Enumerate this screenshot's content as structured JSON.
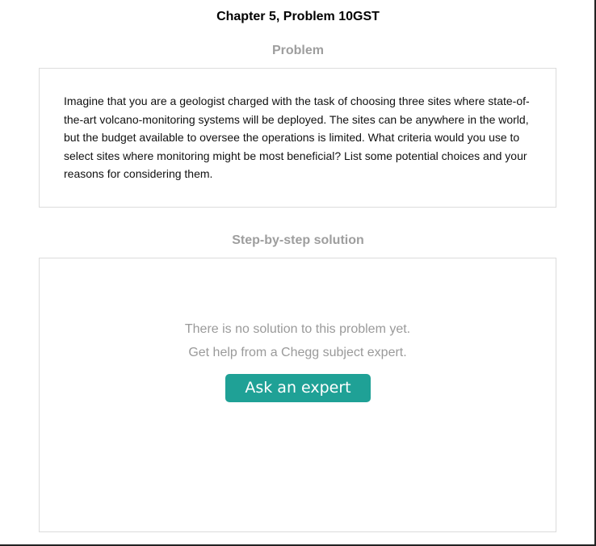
{
  "page": {
    "title": "Chapter 5, Problem 10GST"
  },
  "problem": {
    "heading": "Problem",
    "text": "Imagine that you are a geologist charged with the task of choosing three sites where state-of-the-art volcano-monitoring systems will be deployed. The sites can be anywhere in the world, but the budget available to oversee the operations is limited. What criteria would you use to select sites where monitoring might be most beneficial? List some potential choices and your reasons for considering them."
  },
  "solution": {
    "heading": "Step-by-step solution",
    "message_line1": "There is no solution to this problem yet.",
    "message_line2": "Get help from a Chegg subject expert.",
    "button_label": "Ask an expert",
    "button_color": "#1fa196"
  }
}
